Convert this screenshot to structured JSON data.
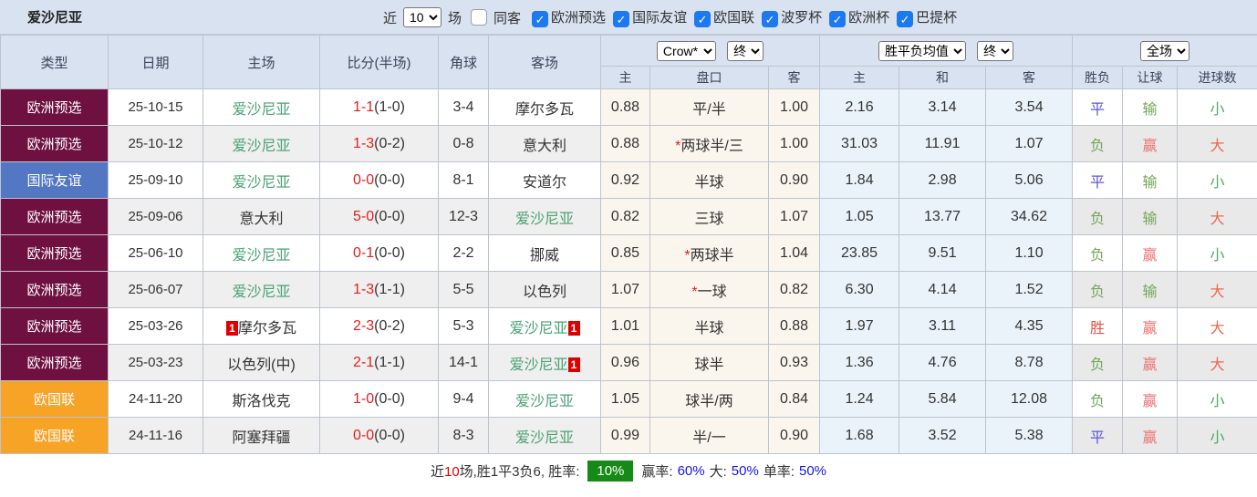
{
  "topbar": {
    "title": "爱沙尼亚",
    "near_label": "近",
    "games_value": "10",
    "games_label": "场",
    "same_away_label": "同客",
    "leagues": [
      {
        "label": "欧洲预选",
        "checked": true
      },
      {
        "label": "国际友谊",
        "checked": true
      },
      {
        "label": "欧国联",
        "checked": true
      },
      {
        "label": "波罗杯",
        "checked": true
      },
      {
        "label": "欧洲杯",
        "checked": true
      },
      {
        "label": "巴提杯",
        "checked": true
      }
    ]
  },
  "table": {
    "columns": [
      "类型",
      "日期",
      "主场",
      "比分(半场)",
      "角球",
      "客场"
    ],
    "sub_columns": [
      "主",
      "盘口",
      "客",
      "主",
      "和",
      "客",
      "胜负",
      "让球",
      "进球数"
    ],
    "selects": {
      "bookmaker": "Crow*",
      "bookmaker_state": "终",
      "avg": "胜平负均值",
      "avg_state": "终",
      "period": "全场"
    },
    "red_card_text": "1",
    "rows": [
      {
        "type": "欧洲预选",
        "date": "25-10-15",
        "home": {
          "name": "爱沙尼亚",
          "main": true,
          "red": null
        },
        "score_ft": "1-1",
        "score_ht": "(1-0)",
        "corners": "3-4",
        "away": {
          "name": "摩尔多瓦",
          "main": false,
          "red": null
        },
        "odds": [
          "0.88",
          "平/半",
          "1.00"
        ],
        "avg": [
          "2.16",
          "3.14",
          "3.54"
        ],
        "results": [
          "平",
          "输",
          "小"
        ]
      },
      {
        "type": "欧洲预选",
        "date": "25-10-12",
        "home": {
          "name": "爱沙尼亚",
          "main": true,
          "red": null
        },
        "score_ft": "1-3",
        "score_ht": "(0-2)",
        "corners": "0-8",
        "away": {
          "name": "意大利",
          "main": false,
          "red": null
        },
        "odds": [
          "0.88",
          "*两球半/三",
          "1.00"
        ],
        "avg": [
          "31.03",
          "11.91",
          "1.07"
        ],
        "results": [
          "负",
          "赢",
          "大"
        ]
      },
      {
        "type": "国际友谊",
        "date": "25-09-10",
        "home": {
          "name": "爱沙尼亚",
          "main": true,
          "red": null
        },
        "score_ft": "0-0",
        "score_ht": "(0-0)",
        "corners": "8-1",
        "away": {
          "name": "安道尔",
          "main": false,
          "red": null
        },
        "odds": [
          "0.92",
          "半球",
          "0.90"
        ],
        "avg": [
          "1.84",
          "2.98",
          "5.06"
        ],
        "results": [
          "平",
          "输",
          "小"
        ]
      },
      {
        "type": "欧洲预选",
        "date": "25-09-06",
        "home": {
          "name": "意大利",
          "main": false,
          "red": null
        },
        "score_ft": "5-0",
        "score_ht": "(0-0)",
        "corners": "12-3",
        "away": {
          "name": "爱沙尼亚",
          "main": true,
          "red": null
        },
        "odds": [
          "0.82",
          "三球",
          "1.07"
        ],
        "avg": [
          "1.05",
          "13.77",
          "34.62"
        ],
        "results": [
          "负",
          "输",
          "大"
        ]
      },
      {
        "type": "欧洲预选",
        "date": "25-06-10",
        "home": {
          "name": "爱沙尼亚",
          "main": true,
          "red": null
        },
        "score_ft": "0-1",
        "score_ht": "(0-0)",
        "corners": "2-2",
        "away": {
          "name": "挪威",
          "main": false,
          "red": null
        },
        "odds": [
          "0.85",
          "*两球半",
          "1.04"
        ],
        "avg": [
          "23.85",
          "9.51",
          "1.10"
        ],
        "results": [
          "负",
          "赢",
          "小"
        ]
      },
      {
        "type": "欧洲预选",
        "date": "25-06-07",
        "home": {
          "name": "爱沙尼亚",
          "main": true,
          "red": null
        },
        "score_ft": "1-3",
        "score_ht": "(1-1)",
        "corners": "5-5",
        "away": {
          "name": "以色列",
          "main": false,
          "red": null
        },
        "odds": [
          "1.07",
          "*一球",
          "0.82"
        ],
        "avg": [
          "6.30",
          "4.14",
          "1.52"
        ],
        "results": [
          "负",
          "输",
          "大"
        ]
      },
      {
        "type": "欧洲预选",
        "date": "25-03-26",
        "home": {
          "name": "摩尔多瓦",
          "main": false,
          "red": "before"
        },
        "score_ft": "2-3",
        "score_ht": "(0-2)",
        "corners": "5-3",
        "away": {
          "name": "爱沙尼亚",
          "main": true,
          "red": "after"
        },
        "odds": [
          "1.01",
          "半球",
          "0.88"
        ],
        "avg": [
          "1.97",
          "3.11",
          "4.35"
        ],
        "results": [
          "胜",
          "赢",
          "大"
        ]
      },
      {
        "type": "欧洲预选",
        "date": "25-03-23",
        "home": {
          "name": "以色列(中)",
          "main": false,
          "red": null
        },
        "score_ft": "2-1",
        "score_ht": "(1-1)",
        "corners": "14-1",
        "away": {
          "name": "爱沙尼亚",
          "main": true,
          "red": "after"
        },
        "odds": [
          "0.96",
          "球半",
          "0.93"
        ],
        "avg": [
          "1.36",
          "4.76",
          "8.78"
        ],
        "results": [
          "负",
          "赢",
          "大"
        ]
      },
      {
        "type": "欧国联",
        "date": "24-11-20",
        "home": {
          "name": "斯洛伐克",
          "main": false,
          "red": null
        },
        "score_ft": "1-0",
        "score_ht": "(0-0)",
        "corners": "9-4",
        "away": {
          "name": "爱沙尼亚",
          "main": true,
          "red": null
        },
        "odds": [
          "1.05",
          "球半/两",
          "0.84"
        ],
        "avg": [
          "1.24",
          "5.84",
          "12.08"
        ],
        "results": [
          "负",
          "赢",
          "小"
        ]
      },
      {
        "type": "欧国联",
        "date": "24-11-16",
        "home": {
          "name": "阿塞拜疆",
          "main": false,
          "red": null
        },
        "score_ft": "0-0",
        "score_ht": "(0-0)",
        "corners": "8-3",
        "away": {
          "name": "爱沙尼亚",
          "main": true,
          "red": null
        },
        "odds": [
          "0.99",
          "半/一",
          "0.90"
        ],
        "avg": [
          "1.68",
          "3.52",
          "5.38"
        ],
        "results": [
          "平",
          "赢",
          "小"
        ]
      }
    ]
  },
  "footer": {
    "near": "近",
    "count": "10",
    "record": "场,胜1平3负6, 胜率:",
    "rate": "10%",
    "stats": [
      {
        "label": "赢率:",
        "value": "60%"
      },
      {
        "label": "大:",
        "value": "50%"
      },
      {
        "label": "单率:",
        "value": "50%"
      }
    ]
  },
  "colors": {
    "league": {
      "欧洲预选": "#6E1040",
      "国际友谊": "#5377C2",
      "欧国联": "#F6A326"
    },
    "result": {
      "胜": "#E05548",
      "平": "#5D55D5",
      "负": "#74A65A",
      "赢": "#EA7272",
      "输": "#74A65A",
      "大": "#EC6852",
      "小": "#54A56A"
    },
    "score_red": "#E31E1E",
    "team_green": "#4AA173",
    "red_card_bg": "#DD0000",
    "rate_badge_bg": "#168A16",
    "stat_value_blue": "#1414E8"
  }
}
